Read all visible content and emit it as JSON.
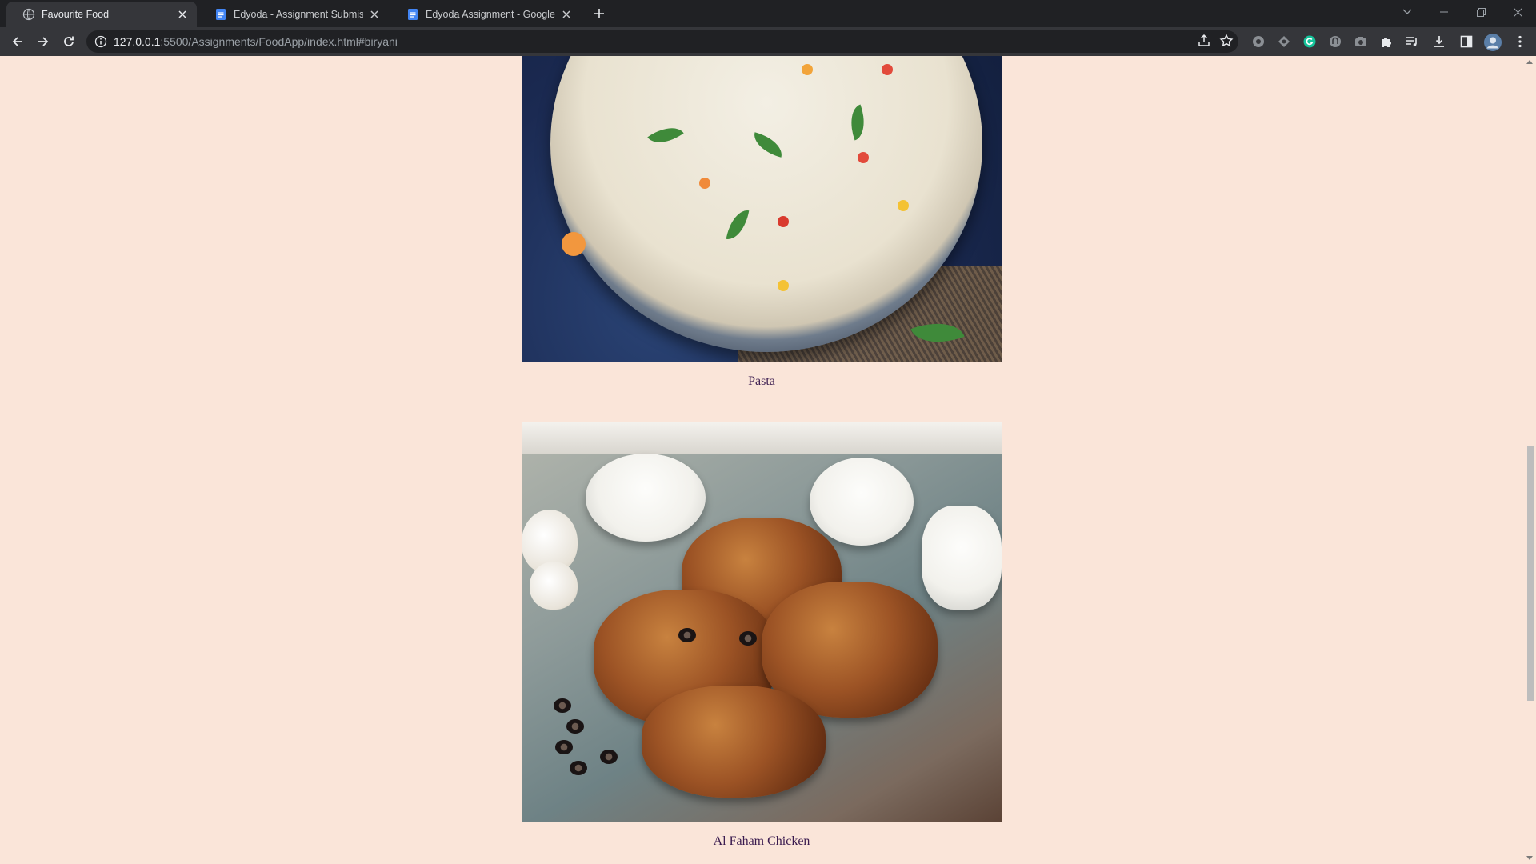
{
  "browser": {
    "tabs": [
      {
        "title": "Favourite Food",
        "active": true,
        "icon": "globe-icon"
      },
      {
        "title": "Edyoda - Assignment Submission",
        "active": false,
        "icon": "google-docs-icon"
      },
      {
        "title": "Edyoda Assignment - Google Docs",
        "active": false,
        "icon": "google-docs-icon"
      }
    ],
    "url": {
      "host": "127.0.0.1",
      "rest": ":5500/Assignments/FoodApp/index.html#biryani"
    }
  },
  "page": {
    "foods": [
      {
        "name": "Pasta"
      },
      {
        "name": "Al Faham Chicken"
      }
    ]
  },
  "colors": {
    "page_background": "#fae5d9",
    "caption_text": "#3a1b4f",
    "browser_frame": "#202124",
    "toolbar": "#35363a"
  }
}
